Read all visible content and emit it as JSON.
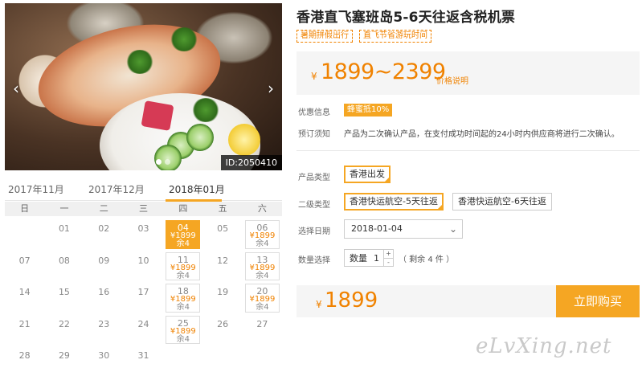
{
  "photo": {
    "id_label": "ID:2050410",
    "prev_arrow": "‹",
    "next_arrow": "›"
  },
  "calendar": {
    "months": [
      "2017年11月",
      "2017年12月",
      "2018年01月"
    ],
    "weekdays": [
      "日",
      "一",
      "二",
      "三",
      "四",
      "五",
      "六"
    ],
    "days": [
      {
        "d": ""
      },
      {
        "d": "01"
      },
      {
        "d": "02"
      },
      {
        "d": "03"
      },
      {
        "d": "04",
        "price": "¥1899",
        "stock": "余4",
        "selected": true
      },
      {
        "d": "05"
      },
      {
        "d": "06",
        "price": "¥1899",
        "stock": "余4"
      },
      {
        "d": "07"
      },
      {
        "d": "08"
      },
      {
        "d": "09"
      },
      {
        "d": "10"
      },
      {
        "d": "11",
        "price": "¥1899",
        "stock": "余4"
      },
      {
        "d": "12"
      },
      {
        "d": "13",
        "price": "¥1899",
        "stock": "余4"
      },
      {
        "d": "14"
      },
      {
        "d": "15"
      },
      {
        "d": "16"
      },
      {
        "d": "17"
      },
      {
        "d": "18",
        "price": "¥1899",
        "stock": "余4"
      },
      {
        "d": "19"
      },
      {
        "d": "20",
        "price": "¥1899",
        "stock": "余4"
      },
      {
        "d": "21"
      },
      {
        "d": "22"
      },
      {
        "d": "23"
      },
      {
        "d": "24"
      },
      {
        "d": "25",
        "price": "¥1899",
        "stock": "余4"
      },
      {
        "d": "26"
      },
      {
        "d": "27"
      },
      {
        "d": "28"
      },
      {
        "d": "29"
      },
      {
        "d": "30"
      },
      {
        "d": "31"
      }
    ]
  },
  "product": {
    "title": "香港直飞塞班岛5-6天往返含税机票",
    "tags": [
      "暑期拼假出行",
      "直飞节省游玩时间"
    ],
    "price_currency": "¥",
    "price_range": "1899~2399",
    "price_note": "价格说明",
    "discount_label": "优惠信息",
    "discount_value": "蜂蜜抵10%",
    "policy_label": "预订须知",
    "policy_text": "产品为二次确认产品，在支付成功时间起的24小时内供应商将进行二次确认。"
  },
  "options": {
    "type_label": "产品类型",
    "type_values": [
      "香港出发"
    ],
    "sub_label": "二级类型",
    "sub_values": [
      "香港快运航空-5天往返",
      "香港快运航空-6天往返"
    ],
    "date_label": "选择日期",
    "date_value": "2018-01-04",
    "date_chevron": "⌄",
    "qty_label": "数量选择",
    "qty_field_label": "数量",
    "qty_value": "1",
    "qty_plus": "+",
    "qty_minus": "-",
    "stock_text": "（ 剩余 4 件 ）"
  },
  "buy": {
    "currency": "¥",
    "price": "1899",
    "button": "立即购买"
  },
  "watermark": "eLvXing.net",
  "colors": {
    "accent": "#f5a623",
    "price": "#f08200"
  }
}
